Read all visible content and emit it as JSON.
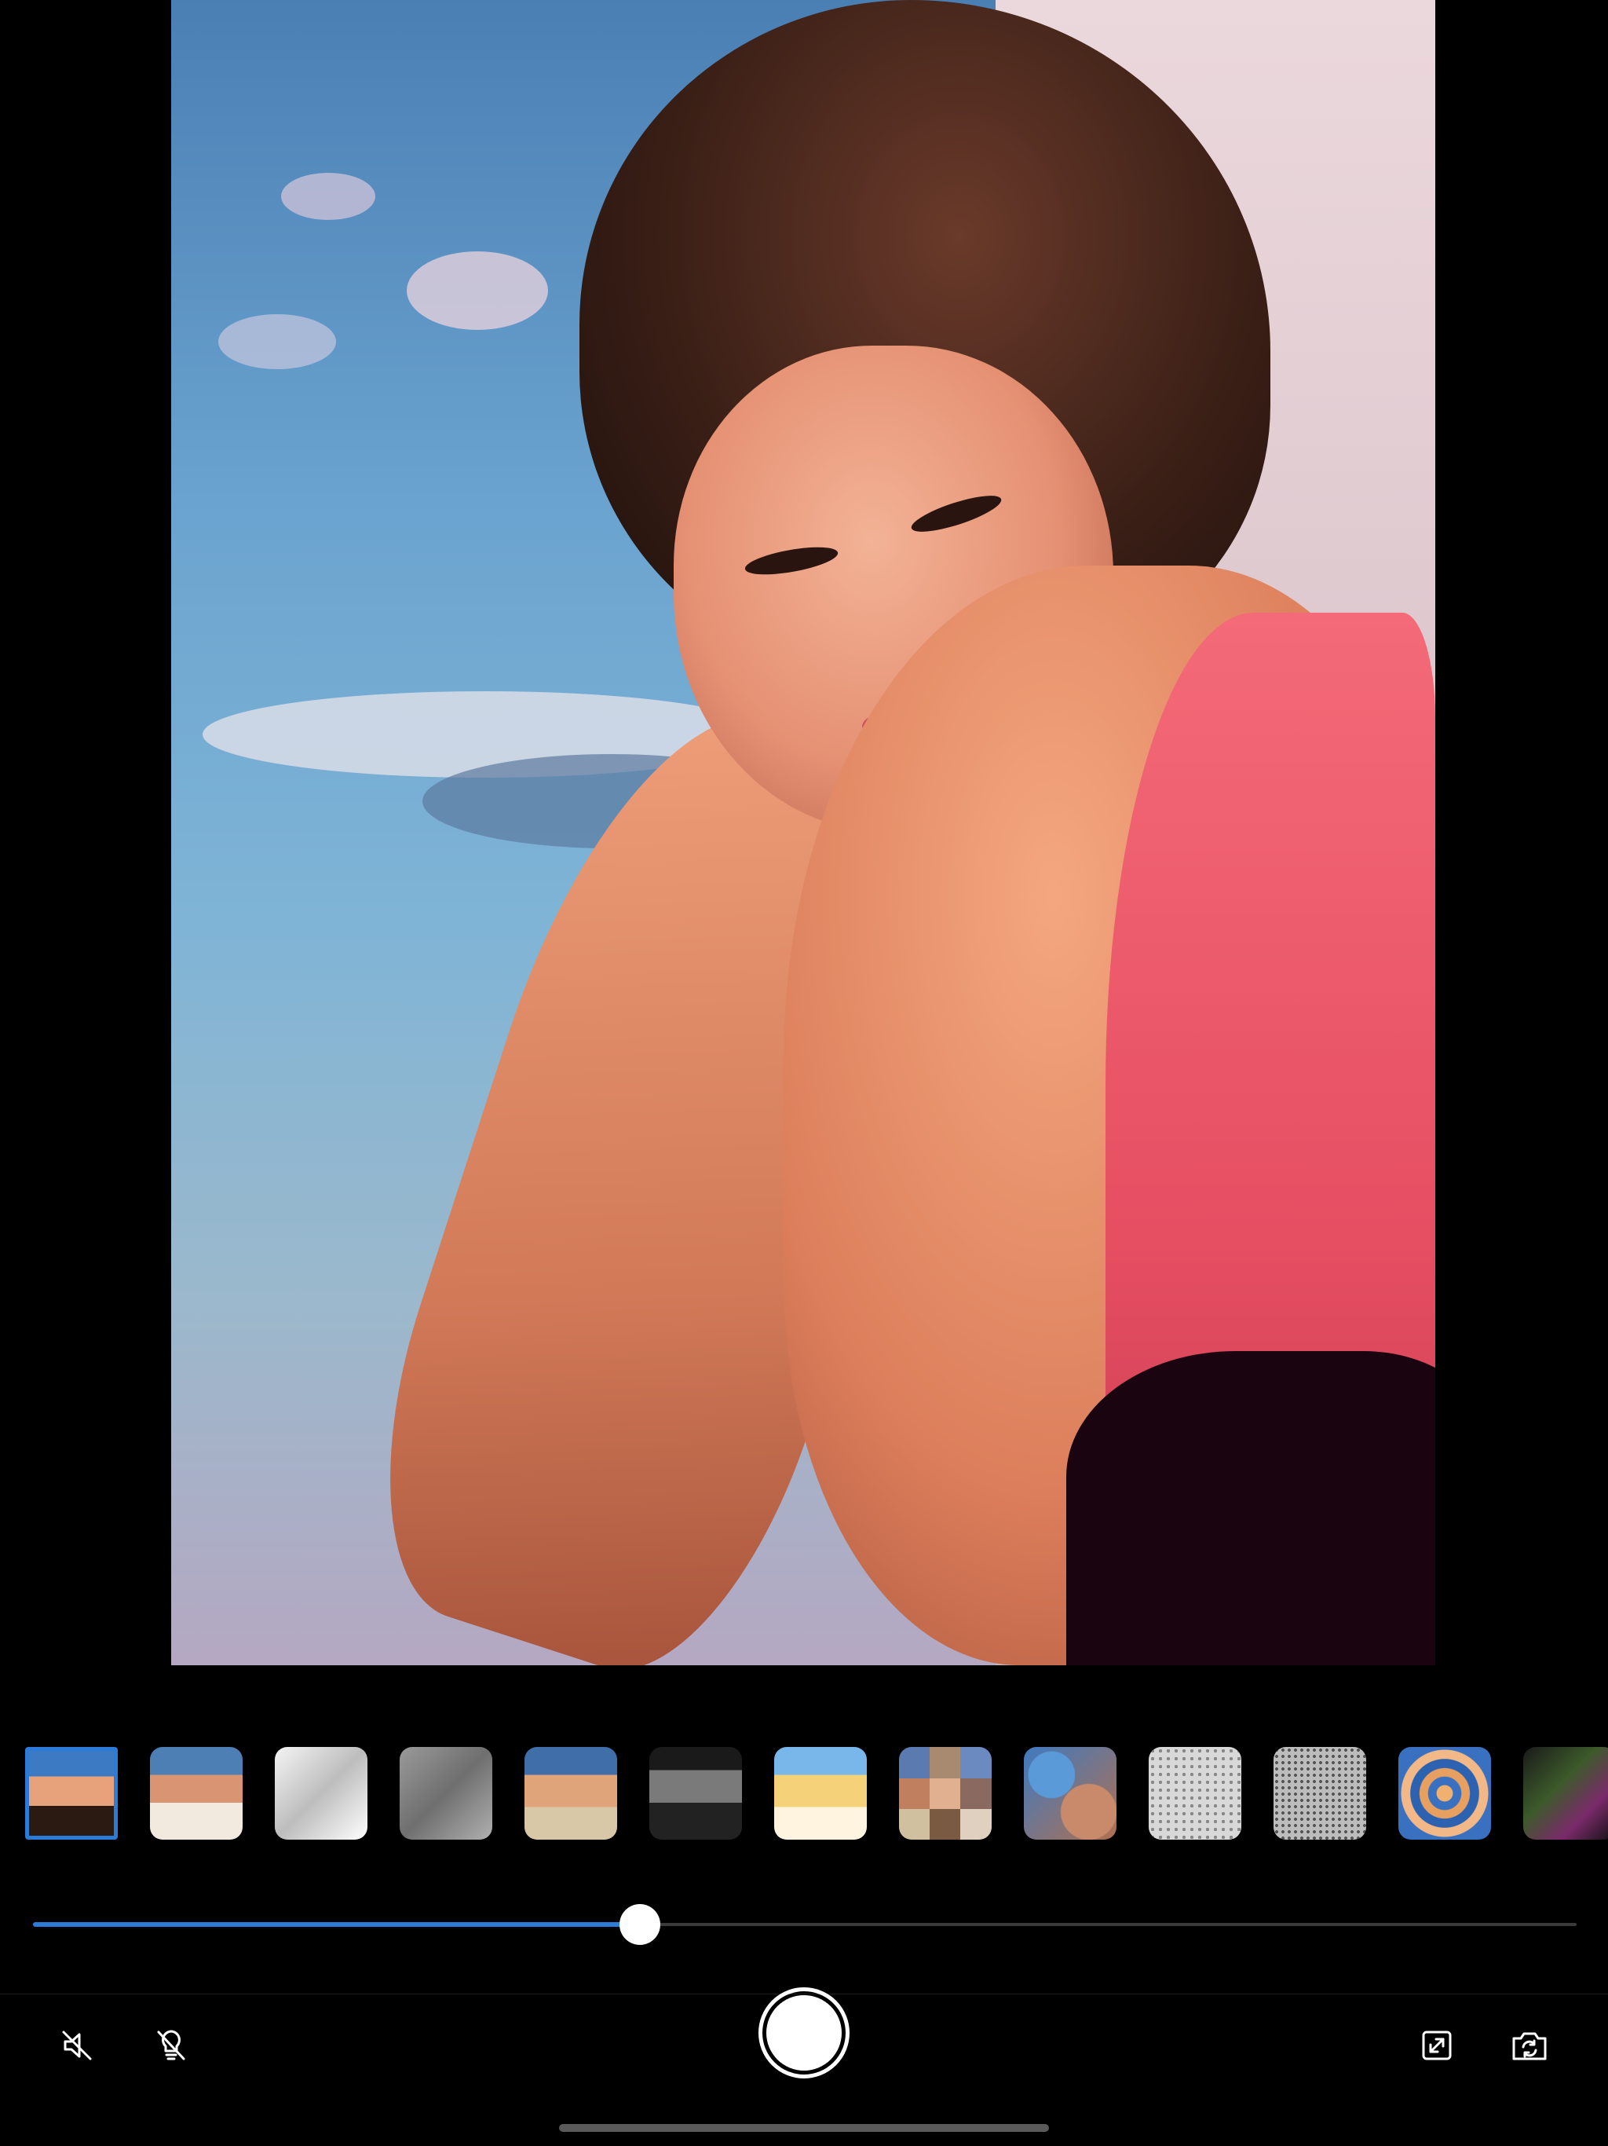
{
  "app": {
    "accent_color": "#2c7bd8",
    "background_color": "#000000"
  },
  "viewfinder": {
    "content": "filtered-portrait-photo"
  },
  "filters": {
    "selected_index": 0,
    "items": [
      {
        "icon": "filter-cartoon-thumb",
        "selected": true
      },
      {
        "icon": "filter-original-thumb"
      },
      {
        "icon": "filter-sketch-thumb"
      },
      {
        "icon": "filter-emboss-thumb"
      },
      {
        "icon": "filter-warm-thumb"
      },
      {
        "icon": "filter-mono-thumb"
      },
      {
        "icon": "filter-bright-thumb"
      },
      {
        "icon": "filter-pixelate-thumb"
      },
      {
        "icon": "filter-crystal-thumb"
      },
      {
        "icon": "filter-halftone-thumb"
      },
      {
        "icon": "filter-dots-thumb"
      },
      {
        "icon": "filter-twirl-thumb"
      },
      {
        "icon": "filter-neon-thumb"
      }
    ]
  },
  "intensity": {
    "value": 0.393
  },
  "toolbar": {
    "left": [
      {
        "icon": "mute-icon"
      },
      {
        "icon": "flash-off-icon"
      }
    ],
    "center": {
      "icon": "shutter-button"
    },
    "right": [
      {
        "icon": "aspect-ratio-icon"
      },
      {
        "icon": "switch-camera-icon"
      }
    ]
  }
}
